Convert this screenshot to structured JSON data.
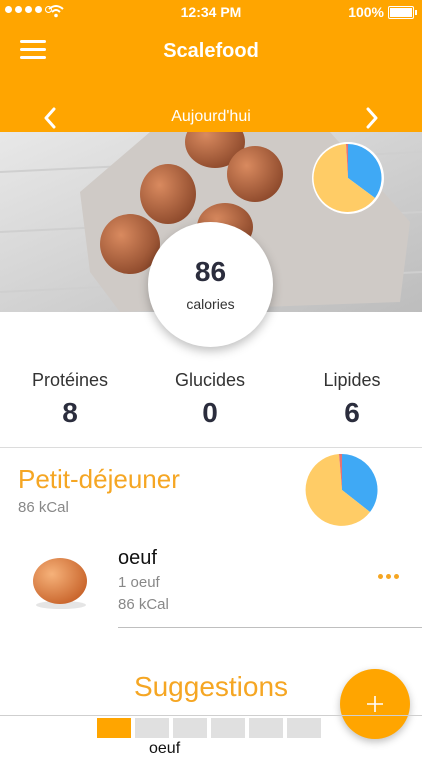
{
  "status_bar": {
    "time": "12:34 PM",
    "battery": "100%"
  },
  "header": {
    "title": "Scalefood",
    "date_label": "Aujourd'hui"
  },
  "summary": {
    "calories_value": "86",
    "calories_label": "calories"
  },
  "macros": [
    {
      "label": "Protéines",
      "value": "8"
    },
    {
      "label": "Glucides",
      "value": "0"
    },
    {
      "label": "Lipides",
      "value": "6"
    }
  ],
  "meal": {
    "title": "Petit-déjeuner",
    "kcal": "86 kCal",
    "items": [
      {
        "name": "oeuf",
        "quantity": "1 oeuf",
        "kcal": "86 kCal"
      }
    ]
  },
  "suggestions": {
    "title": "Suggestions",
    "preview_text": "oeuf"
  },
  "colors": {
    "accent": "#FFA500",
    "title_orange": "#F5A623",
    "pie_blue": "#3FA9F5",
    "pie_yellow": "#FFCC66",
    "pie_red": "#E57373"
  },
  "pagination": {
    "pages": 6,
    "active": 0
  }
}
